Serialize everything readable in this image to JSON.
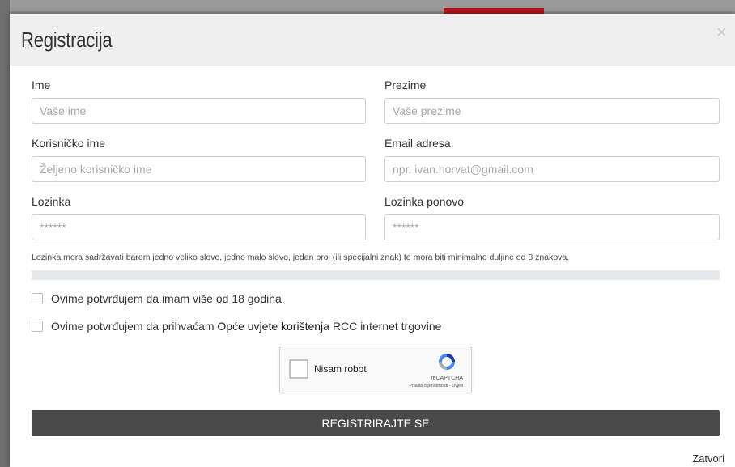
{
  "modal": {
    "title": "Registracija",
    "close_symbol": "×"
  },
  "form": {
    "first_name": {
      "label": "Ime",
      "placeholder": "Vaše ime"
    },
    "last_name": {
      "label": "Prezime",
      "placeholder": "Vaše prezime"
    },
    "username": {
      "label": "Korisničko ime",
      "placeholder": "Željeno korisničko ime"
    },
    "email": {
      "label": "Email adresa",
      "placeholder": "npr. ivan.horvat@gmail.com"
    },
    "password": {
      "label": "Lozinka",
      "placeholder": "******"
    },
    "password_repeat": {
      "label": "Lozinka ponovo",
      "placeholder": "******"
    },
    "password_hint": "Lozinka mora sadržavati barem jedno veliko slovo, jedno malo slovo, jedan broj (ili specijalni znak) te mora biti minimalne duljine od 8 znakova.",
    "password_strength": 0
  },
  "checkboxes": {
    "age": {
      "text": "Ovime potvrđujem da imam više od 18 godina",
      "checked": false
    },
    "terms": {
      "prefix": "Ovime potvrđujem da prihvaćam ",
      "link": "Opće uvjete korištenja",
      "suffix": " RCC internet trgovine",
      "checked": false
    }
  },
  "captcha": {
    "label": "Nisam robot",
    "brand": "reCAPTCHA",
    "links": "Pravila o privatnosti - Uvjeti"
  },
  "actions": {
    "submit_label": "REGISTRIRAJTE SE",
    "close_label": "Zatvori"
  },
  "colors": {
    "header_bg": "#efefef",
    "button_bg": "#4a4a4a",
    "accent_red": "#b3141b"
  }
}
